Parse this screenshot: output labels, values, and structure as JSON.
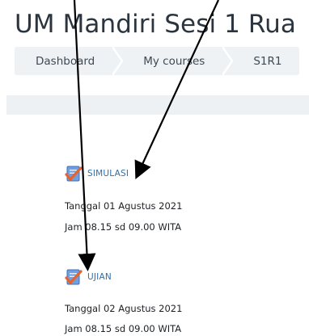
{
  "page": {
    "title": "UM Mandiri Sesi 1 Rua"
  },
  "breadcrumb": {
    "items": [
      {
        "label": "Dashboard"
      },
      {
        "label": "My courses"
      },
      {
        "label": "S1R1"
      }
    ]
  },
  "activities": [
    {
      "icon": "assignment-check-icon",
      "link_label": "SIMULASI",
      "date_line": "Tanggal 01 Agustus 2021",
      "time_line": "Jam 08.15 sd 09.00 WITA"
    },
    {
      "icon": "assignment-check-icon",
      "link_label": "UJIAN",
      "date_line": "Tanggal 02 Agustus 2021",
      "time_line": "Jam 08.15 sd 09.00 WITA"
    }
  ],
  "colors": {
    "link": "#2e6fa8",
    "breadcrumb_bg": "#eef2f5",
    "annotation_arrow": "#000000",
    "icon_check": "#e8632b",
    "icon_paper": "#5b8fd1"
  }
}
